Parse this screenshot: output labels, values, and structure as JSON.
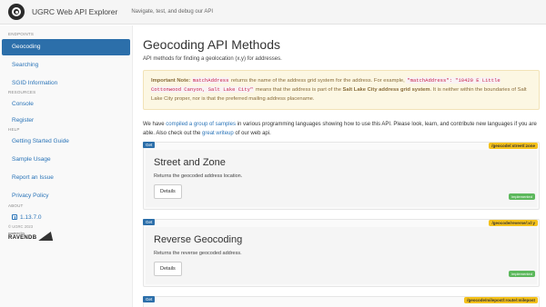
{
  "navbar": {
    "logo_icon": "ugrc-logo-icon",
    "brand": "UGRC Web API Explorer",
    "tagline": "Navigate, test, and debug our API"
  },
  "sidebar": {
    "endpoints_heading": "ENDPOINTS",
    "endpoints": [
      {
        "label": "Geocoding",
        "active": true
      },
      {
        "label": "Searching",
        "active": false
      },
      {
        "label": "SGID Information",
        "active": false
      }
    ],
    "resources_heading": "RESOURCES",
    "resources": [
      {
        "label": "Console"
      },
      {
        "label": "Register"
      }
    ],
    "help_heading": "HELP",
    "help": [
      {
        "label": "Getting Started Guide"
      },
      {
        "label": "Sample Usage"
      },
      {
        "label": "Report an Issue"
      },
      {
        "label": "Privacy Policy"
      }
    ],
    "about_heading": "ABOUT",
    "version": "1.13.7.0",
    "copyright": "© UGRC 2023",
    "powered_by": "powered by",
    "powered_brand": "RAVENDB"
  },
  "main": {
    "title": "Geocoding API Methods",
    "subtitle": "API methods for finding a geolocation (x,y) for addresses.",
    "note": {
      "label": "Important Note:",
      "code1": "matchAddress",
      "text1": " returns the name of the address grid system for the address. For example, ",
      "code2": "\"matchAddress\": \"10420 E Little Cottonwood Canyon, Salt Lake City\"",
      "text2": " means that the address is part of the ",
      "bold": "Salt Lake City address grid system",
      "text3": ". It is neither within the boundaries of Salt Lake City proper, nor is that the preferred mailing address placename."
    },
    "intro": {
      "t1": "We have ",
      "link1": "compiled a group of samples",
      "t2": " in various programming languages showing how to use this API. Please look, learn, and contribute new languages if you are able. Also check out the ",
      "link2": "great writeup",
      "t3": " of our web api."
    },
    "endpoints": [
      {
        "method": "Get",
        "route": "/geocode/:street/:zone",
        "title": "Street and Zone",
        "description": "Returns the geocoded address location.",
        "details_label": "Details",
        "status": "implemented"
      },
      {
        "method": "Get",
        "route": "/geocode/reverse/:x/:y",
        "title": "Reverse Geocoding",
        "description": "Returns the reverse geocoded address.",
        "details_label": "Details",
        "status": "implemented"
      },
      {
        "method": "Get",
        "route": "/geocode/milepost/:route/:milepost"
      }
    ]
  }
}
